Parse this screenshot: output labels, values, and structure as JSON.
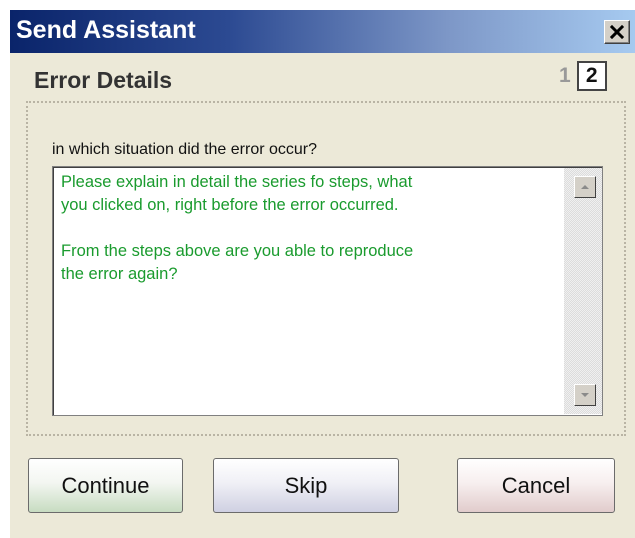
{
  "window": {
    "title": "Send Assistant",
    "close_icon": "close-icon"
  },
  "header": {
    "section_title": "Error Details",
    "steps": [
      "1",
      "2"
    ],
    "active_step": "2"
  },
  "form": {
    "prompt_label": "in which situation did the error occur?",
    "textarea_value": "Please explain in detail the series fo steps, what\nyou clicked on, right before the error occurred.\n\nFrom the steps above are you able to reproduce\nthe error again?"
  },
  "buttons": {
    "continue_label": "Continue",
    "skip_label": "Skip",
    "cancel_label": "Cancel"
  },
  "colors": {
    "titlebar_start": "#0a246a",
    "titlebar_end": "#a6caf0",
    "dialog_bg": "#ece9d8",
    "textarea_text": "#1a9b2e"
  }
}
